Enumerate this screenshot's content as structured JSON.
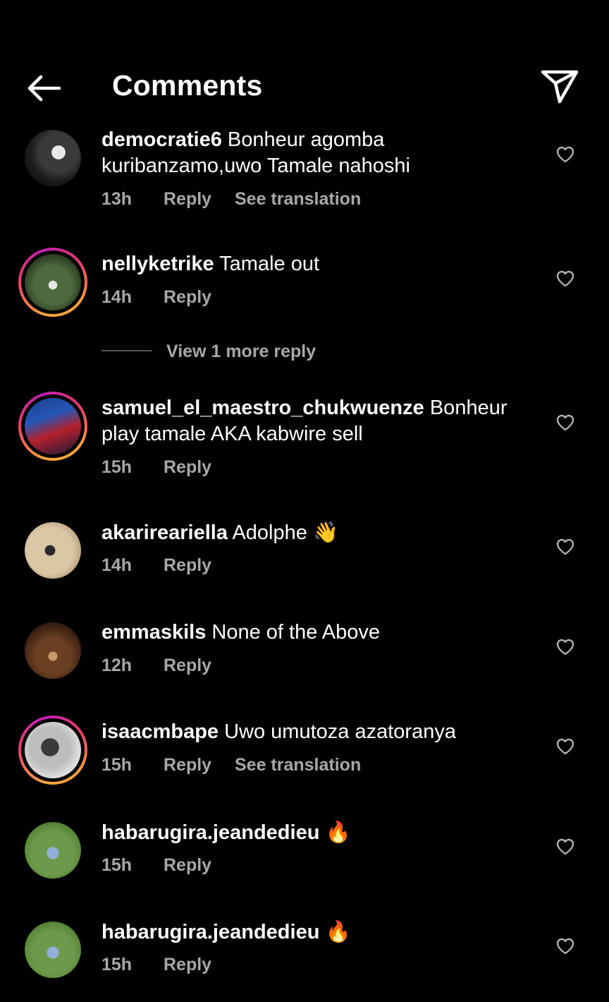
{
  "header": {
    "title": "Comments",
    "back_icon": "arrow-left-icon",
    "share_icon": "send-icon"
  },
  "comments": [
    {
      "username": "democratie6",
      "text": "Bonheur agomba kuribanzamo,uwo Tamale nahoshi",
      "time": "13h",
      "reply": "Reply",
      "translate": "See translation"
    },
    {
      "username": "nellyketrike",
      "text": "Tamale out",
      "time": "14h",
      "reply": "Reply"
    },
    {
      "username": "samuel_el_maestro_chukwuenze",
      "text": "Bonheur play tamale AKA kabwire sell",
      "time": "15h",
      "reply": "Reply"
    },
    {
      "username": "akarireariella",
      "text": "Adolphe",
      "emoji": "👋",
      "time": "14h",
      "reply": "Reply"
    },
    {
      "username": "emmaskils",
      "text": "None of the Above",
      "time": "12h",
      "reply": "Reply"
    },
    {
      "username": "isaacmbape",
      "text": "Uwo umutoza azatoranya",
      "time": "15h",
      "reply": "Reply",
      "translate": "See translation"
    },
    {
      "username": "habarugira.jeandedieu",
      "text": "",
      "emoji": "🔥",
      "time": "15h",
      "reply": "Reply"
    },
    {
      "username": "habarugira.jeandedieu",
      "text": "",
      "emoji": "🔥",
      "time": "15h",
      "reply": "Reply"
    }
  ],
  "view_more_replies": "View 1 more reply",
  "colors": {
    "background": "#000000",
    "secondary_text": "#a8a8a8",
    "story_ring_start": "#f9a23b",
    "story_ring_end": "#c01fb3"
  }
}
